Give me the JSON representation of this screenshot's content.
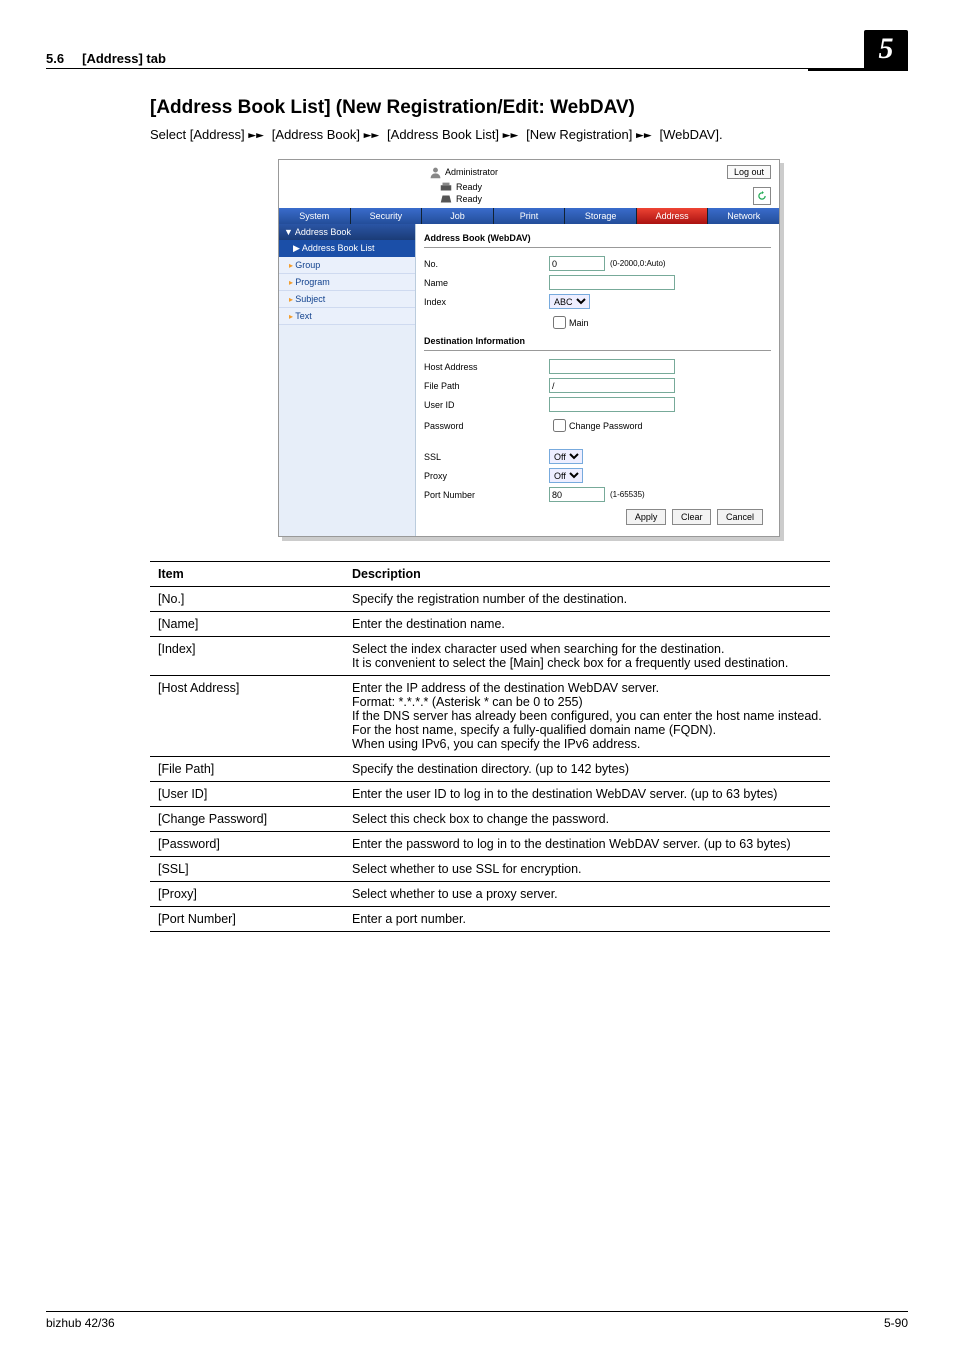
{
  "header": {
    "section": "5.6",
    "tab_label": "[Address] tab",
    "chapter_num": "5"
  },
  "title": "[Address Book List] (New Registration/Edit: WebDAV)",
  "breadcrumb": {
    "prefix": "Select ",
    "parts": [
      "[Address]",
      "[Address Book]",
      "[Address Book List]",
      "[New Registration]",
      "[WebDAV]"
    ],
    "suffix": "."
  },
  "screenshot": {
    "admin": "Administrator",
    "logout": "Log out",
    "ready": "Ready",
    "tabs": [
      "System",
      "Security",
      "Job",
      "Print",
      "Storage",
      "Address",
      "Network"
    ],
    "active_tab_index": 5,
    "sidebar": {
      "heading": "▼ Address Book",
      "selected": "▶ Address Book List",
      "items": [
        "Group",
        "Program",
        "Subject",
        "Text"
      ]
    },
    "form": {
      "group1_title": "Address Book (WebDAV)",
      "no_label": "No.",
      "no_value": "0",
      "no_range": "(0-2000,0:Auto)",
      "name_label": "Name",
      "name_value": "",
      "index_label": "Index",
      "index_value": "ABC",
      "main_label": "Main",
      "group2_title": "Destination Information",
      "host_label": "Host Address",
      "host_value": "",
      "file_label": "File Path",
      "file_value": "/",
      "user_label": "User ID",
      "user_value": "",
      "pw_label": "Password",
      "changepw_label": "Change Password",
      "ssl_label": "SSL",
      "ssl_value": "Off",
      "proxy_label": "Proxy",
      "proxy_value": "Off",
      "port_label": "Port Number",
      "port_value": "80",
      "port_range": "(1-65535)",
      "apply": "Apply",
      "clear": "Clear",
      "cancel": "Cancel"
    }
  },
  "table": {
    "hdr_item": "Item",
    "hdr_desc": "Description",
    "rows": [
      {
        "k": "[No.]",
        "v": "Specify the registration number of the destination."
      },
      {
        "k": "[Name]",
        "v": "Enter the destination name."
      },
      {
        "k": "[Index]",
        "v": "Select the index character used when searching for the destination.\nIt is convenient to select the [Main] check box for a frequently used destination."
      },
      {
        "k": "[Host Address]",
        "v": "Enter the IP address of the destination WebDAV server.\nFormat: *.*.*.* (Asterisk * can be 0 to 255)\nIf the DNS server has already been configured, you can enter the host name instead. For the host name, specify a fully-qualified domain name (FQDN).\nWhen using IPv6, you can specify the IPv6 address."
      },
      {
        "k": "[File Path]",
        "v": "Specify the destination directory. (up to 142 bytes)"
      },
      {
        "k": "[User ID]",
        "v": "Enter the user ID to log in to the destination WebDAV server. (up to 63 bytes)"
      },
      {
        "k": "[Change Password]",
        "v": "Select this check box to change the password."
      },
      {
        "k": "[Password]",
        "v": "Enter the password to log in to the destination WebDAV server. (up to 63 bytes)"
      },
      {
        "k": "[SSL]",
        "v": "Select whether to use SSL for encryption."
      },
      {
        "k": "[Proxy]",
        "v": "Select whether to use a proxy server."
      },
      {
        "k": "[Port Number]",
        "v": "Enter a port number."
      }
    ]
  },
  "footer": {
    "left": "bizhub 42/36",
    "right": "5-90"
  }
}
